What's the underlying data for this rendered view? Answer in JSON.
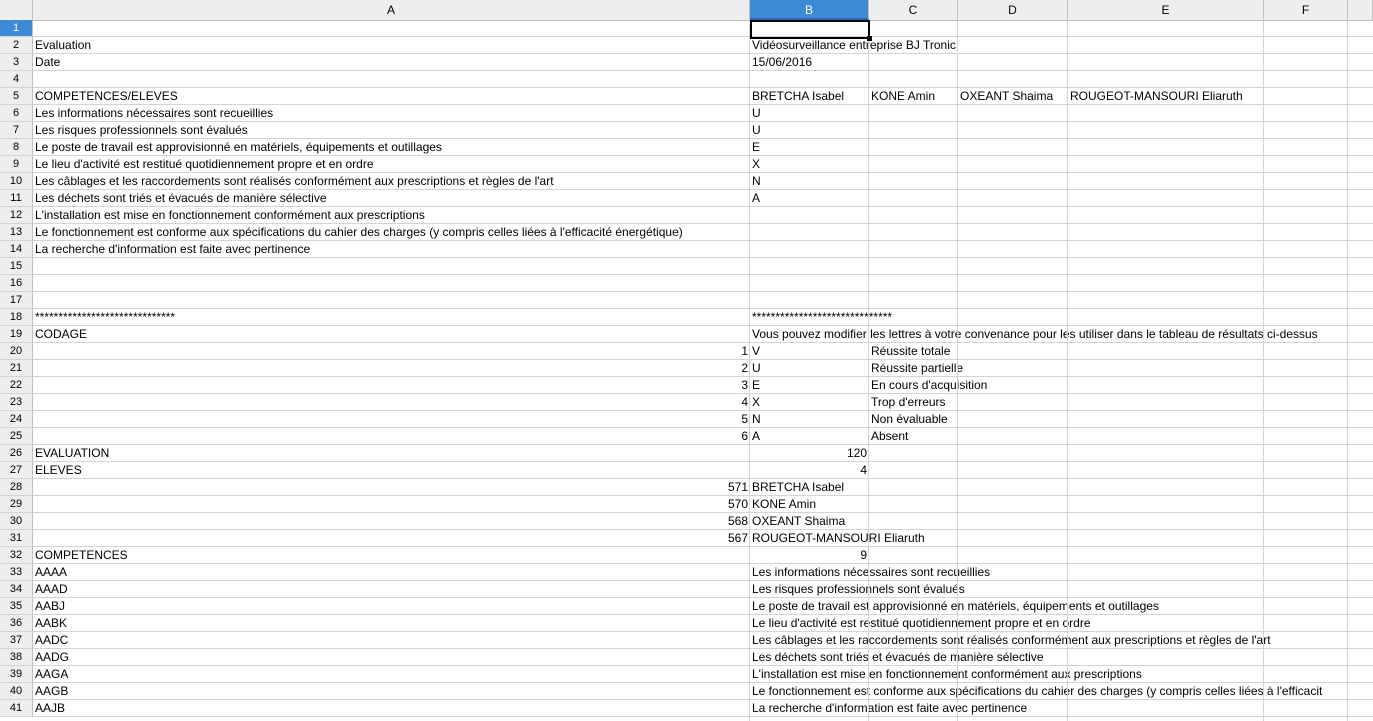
{
  "columns": [
    "A",
    "B",
    "C",
    "D",
    "E",
    "F"
  ],
  "active_column": "B",
  "active_row": 1,
  "rows": [
    {
      "n": 1,
      "a": "",
      "b": "",
      "c": "",
      "d": "",
      "e": ""
    },
    {
      "n": 2,
      "a": "Evaluation",
      "b": "Vidéosurveillance entreprise BJ Tronic",
      "c": "",
      "d": "",
      "e": ""
    },
    {
      "n": 3,
      "a": "Date",
      "b": "15/06/2016",
      "c": "",
      "d": "",
      "e": ""
    },
    {
      "n": 4,
      "a": "",
      "b": "",
      "c": "",
      "d": "",
      "e": ""
    },
    {
      "n": 5,
      "a": "COMPETENCES/ELEVES",
      "b": "BRETCHA Isabel",
      "c": "KONE Amin",
      "d": "OXEANT Shaima",
      "e": "ROUGEOT-MANSOURI Eliaruth"
    },
    {
      "n": 6,
      "a": "Les informations nécessaires sont recueillies",
      "b": "U",
      "c": "",
      "d": "",
      "e": ""
    },
    {
      "n": 7,
      "a": "Les risques professionnels sont évalués",
      "b": "U",
      "c": "",
      "d": "",
      "e": ""
    },
    {
      "n": 8,
      "a": "Le poste de travail est approvisionné en matériels, équipements et outillages",
      "b": "E",
      "c": "",
      "d": "",
      "e": ""
    },
    {
      "n": 9,
      "a": "Le lieu d'activité est restitué quotidiennement propre et en ordre",
      "b": "X",
      "c": "",
      "d": "",
      "e": ""
    },
    {
      "n": 10,
      "a": "Les câblages et les raccordements sont réalisés conformément aux prescriptions et règles de l'art",
      "b": "N",
      "c": "",
      "d": "",
      "e": ""
    },
    {
      "n": 11,
      "a": "Les déchets sont triés et évacués de manière sélective",
      "b": "A",
      "c": "",
      "d": "",
      "e": ""
    },
    {
      "n": 12,
      "a": "L'installation est mise en fonctionnement conformément aux prescriptions",
      "b": "",
      "c": "",
      "d": "",
      "e": ""
    },
    {
      "n": 13,
      "a": "Le fonctionnement est conforme aux spécifications du cahier des charges (y compris celles liées à l'efficacité énergétique)",
      "b": "",
      "c": "",
      "d": "",
      "e": ""
    },
    {
      "n": 14,
      "a": "La recherche d'information est faite avec pertinence",
      "b": "",
      "c": "",
      "d": "",
      "e": ""
    },
    {
      "n": 15,
      "a": "",
      "b": "",
      "c": "",
      "d": "",
      "e": ""
    },
    {
      "n": 16,
      "a": "",
      "b": "",
      "c": "",
      "d": "",
      "e": ""
    },
    {
      "n": 17,
      "a": "",
      "b": "",
      "c": "",
      "d": "",
      "e": ""
    },
    {
      "n": 18,
      "a": "******************************",
      "b": "******************************",
      "c": "",
      "d": "",
      "e": ""
    },
    {
      "n": 19,
      "a": "CODAGE",
      "b": "Vous pouvez modifier les lettres à votre convenance pour les utiliser dans le tableau de résultats ci-dessus",
      "c": "",
      "d": "",
      "e": ""
    },
    {
      "n": 20,
      "a": "1",
      "a_num": true,
      "b": "V",
      "c": "Réussite totale",
      "d": "",
      "e": ""
    },
    {
      "n": 21,
      "a": "2",
      "a_num": true,
      "b": "U",
      "c": "Réussite partielle",
      "d": "",
      "e": ""
    },
    {
      "n": 22,
      "a": "3",
      "a_num": true,
      "b": "E",
      "c": "En cours d'acquisition",
      "d": "",
      "e": ""
    },
    {
      "n": 23,
      "a": "4",
      "a_num": true,
      "b": "X",
      "c": "Trop d'erreurs",
      "d": "",
      "e": ""
    },
    {
      "n": 24,
      "a": "5",
      "a_num": true,
      "b": "N",
      "c": "Non évaluable",
      "d": "",
      "e": ""
    },
    {
      "n": 25,
      "a": "6",
      "a_num": true,
      "b": "A",
      "c": "Absent",
      "d": "",
      "e": ""
    },
    {
      "n": 26,
      "a": "EVALUATION",
      "b": "120",
      "b_num": true,
      "c": "",
      "d": "",
      "e": ""
    },
    {
      "n": 27,
      "a": "ELEVES",
      "b": "4",
      "b_num": true,
      "c": "",
      "d": "",
      "e": ""
    },
    {
      "n": 28,
      "a": "571",
      "a_num": true,
      "b": "BRETCHA Isabel",
      "c": "",
      "d": "",
      "e": ""
    },
    {
      "n": 29,
      "a": "570",
      "a_num": true,
      "b": "KONE Amin",
      "c": "",
      "d": "",
      "e": ""
    },
    {
      "n": 30,
      "a": "568",
      "a_num": true,
      "b": "OXEANT Shaima",
      "c": "",
      "d": "",
      "e": ""
    },
    {
      "n": 31,
      "a": "567",
      "a_num": true,
      "b": "ROUGEOT-MANSOURI Eliaruth",
      "c": "",
      "d": "",
      "e": ""
    },
    {
      "n": 32,
      "a": "COMPETENCES",
      "b": "9",
      "b_num": true,
      "c": "",
      "d": "",
      "e": ""
    },
    {
      "n": 33,
      "a": "AAAA",
      "b": "Les informations nécessaires sont recueillies",
      "c": "",
      "d": "",
      "e": ""
    },
    {
      "n": 34,
      "a": "AAAD",
      "b": "Les risques professionnels sont évalués",
      "c": "",
      "d": "",
      "e": ""
    },
    {
      "n": 35,
      "a": "AABJ",
      "b": "Le poste de travail est approvisionné en matériels, équipements et outillages",
      "c": "",
      "d": "",
      "e": ""
    },
    {
      "n": 36,
      "a": "AABK",
      "b": "Le lieu d'activité est restitué quotidiennement propre et en ordre",
      "c": "",
      "d": "",
      "e": ""
    },
    {
      "n": 37,
      "a": "AADC",
      "b": "Les câblages et les raccordements sont réalisés conformément aux prescriptions et règles de l'art",
      "c": "",
      "d": "",
      "e": ""
    },
    {
      "n": 38,
      "a": "AADG",
      "b": "Les déchets sont triés et évacués de manière sélective",
      "c": "",
      "d": "",
      "e": ""
    },
    {
      "n": 39,
      "a": "AAGA",
      "b": "L'installation est mise en fonctionnement conformément aux prescriptions",
      "c": "",
      "d": "",
      "e": ""
    },
    {
      "n": 40,
      "a": "AAGB",
      "b": "Le fonctionnement est conforme aux spécifications du cahier des charges (y compris celles liées à l'efficacit",
      "c": "",
      "d": "",
      "e": ""
    },
    {
      "n": 41,
      "a": "AAJB",
      "b": "La recherche d'information est faite avec pertinence",
      "c": "",
      "d": "",
      "e": ""
    }
  ]
}
